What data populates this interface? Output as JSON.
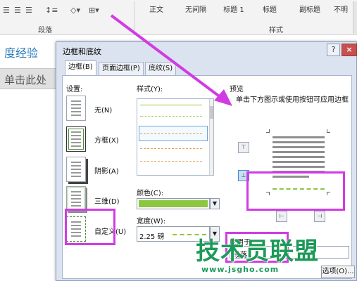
{
  "ribbon": {
    "paragraph_group_label": "段落",
    "styles_group_label": "样式",
    "style_items": [
      "正文",
      "无间隔",
      "标题 1",
      "标题",
      "副标题",
      "不明"
    ]
  },
  "document": {
    "title": "度经验",
    "tab_text": "单击此处"
  },
  "dialog": {
    "title": "边框和底纹",
    "help_label": "?",
    "close_label": "×",
    "tabs": [
      "边框(B)",
      "页面边框(P)",
      "底纹(S)"
    ],
    "settings_label": "设置:",
    "settings": [
      "无(N)",
      "方框(X)",
      "阴影(A)",
      "三维(D)",
      "自定义(U)"
    ],
    "style_label": "样式(Y):",
    "color_label": "颜色(C):",
    "color_value": "#8dc63f",
    "width_label": "宽度(W):",
    "width_value": "2.25 磅",
    "preview_label": "预览",
    "preview_note": "单击下方图示或使用按钮可应用边框",
    "apply_label": "应用于",
    "apply_value": "段落",
    "option_label": "选项(O)..."
  },
  "watermark": {
    "cn_text": "技术员联盟",
    "url_text": "www.jsgho.com"
  },
  "colors": {
    "accent_green": "#8dc63f",
    "highlight_magenta": "#d13be3",
    "watermark_green": "#1c9a59"
  }
}
